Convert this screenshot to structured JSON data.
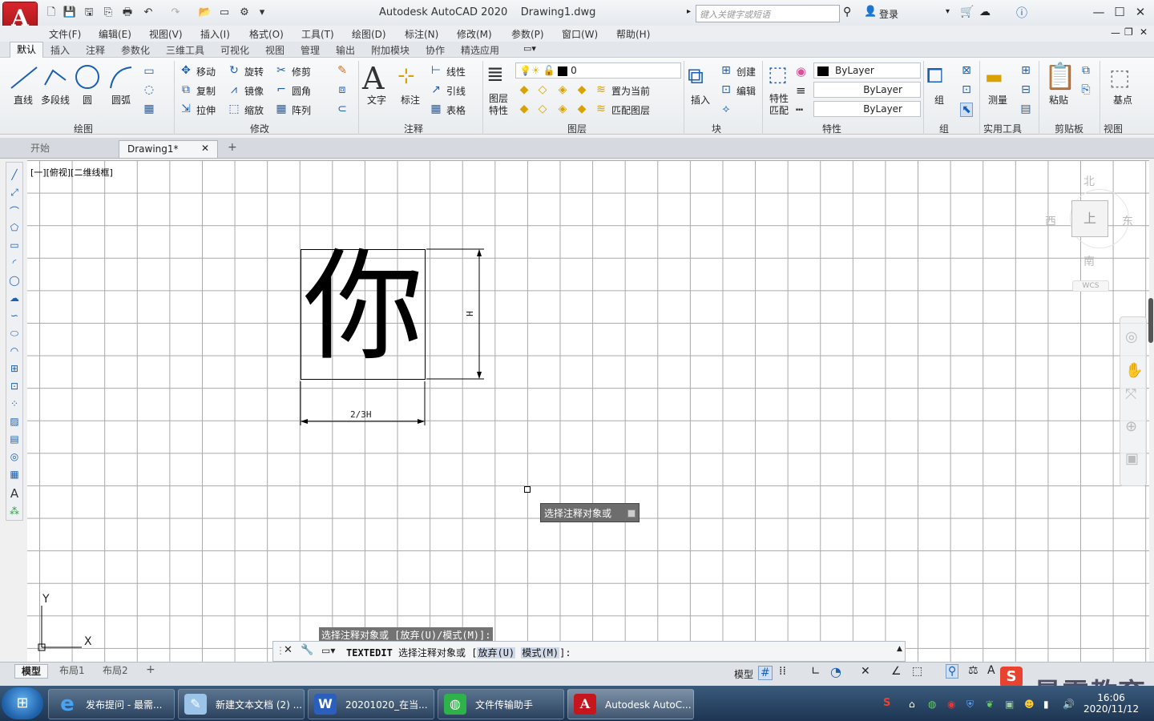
{
  "titlebar": {
    "app_title": "Autodesk AutoCAD 2020",
    "file_name": "Drawing1.dwg",
    "search_placeholder": "键入关键字或短语",
    "login": "登录",
    "logo_letter": "A"
  },
  "menus": [
    "文件(F)",
    "编辑(E)",
    "视图(V)",
    "插入(I)",
    "格式(O)",
    "工具(T)",
    "绘图(D)",
    "标注(N)",
    "修改(M)",
    "参数(P)",
    "窗口(W)",
    "帮助(H)"
  ],
  "ribbon_tabs": [
    "默认",
    "插入",
    "注释",
    "参数化",
    "三维工具",
    "可视化",
    "视图",
    "管理",
    "输出",
    "附加模块",
    "协作",
    "精选应用"
  ],
  "ribbon": {
    "draw": {
      "title": "绘图",
      "line": "直线",
      "polyline": "多段线",
      "circle": "圆",
      "arc": "圆弧"
    },
    "modify": {
      "title": "修改",
      "move": "移动",
      "rotate": "旋转",
      "trim": "修剪",
      "copy": "复制",
      "mirror": "镜像",
      "fillet": "圆角",
      "stretch": "拉伸",
      "scale": "缩放",
      "array": "阵列"
    },
    "annotation": {
      "title": "注释",
      "text": "文字",
      "dim": "标注",
      "linear": "线性",
      "leader": "引线",
      "table": "表格"
    },
    "layers": {
      "title": "图层",
      "props": "图层特性",
      "layer_value": "0",
      "set_current": "置为当前",
      "match_layer": "匹配图层"
    },
    "block": {
      "title": "块",
      "insert": "插入",
      "create": "创建",
      "edit": "编辑"
    },
    "properties": {
      "title": "特性",
      "match": "特性匹配",
      "color": "ByLayer",
      "linetype": "ByLayer",
      "lineweight": "ByLayer"
    },
    "groups": {
      "title": "组",
      "group": "组"
    },
    "utilities": {
      "title": "实用工具",
      "measure": "测量"
    },
    "clipboard": {
      "title": "剪贴板",
      "paste": "粘贴"
    },
    "view": {
      "title": "视图",
      "base": "基点"
    }
  },
  "doc_tabs": {
    "start": "开始",
    "drawing": "Drawing1*"
  },
  "viewport_label": "[一][俯视][二维线框]",
  "drawing": {
    "character": "你",
    "dim_h": "H",
    "dim_w": "2/3H"
  },
  "viewcube": {
    "north": "北",
    "south": "南",
    "east": "东",
    "west": "西",
    "top": "上",
    "wcs": "WCS"
  },
  "ucs": {
    "x": "X",
    "y": "Y"
  },
  "tooltip": "选择注释对象或",
  "command": {
    "history": "选择注释对象或 [放弃(U)/模式(M)]:",
    "name": "TEXTEDIT",
    "prompt": "选择注释对象或 [",
    "opt1": "放弃(U)",
    "opt2": "模式(M)",
    "end": "]:"
  },
  "layout_tabs": [
    "模型",
    "布局1",
    "布局2"
  ],
  "status": {
    "model": "模型"
  },
  "taskbar": {
    "items": [
      "发布提问 - 最需...",
      "新建文本文档 (2) ...",
      "20201020_在当...",
      "文件传输助手",
      "Autodesk AutoC..."
    ],
    "time": "16:06",
    "date": "2020/11/12"
  },
  "watermark": "最需教育"
}
